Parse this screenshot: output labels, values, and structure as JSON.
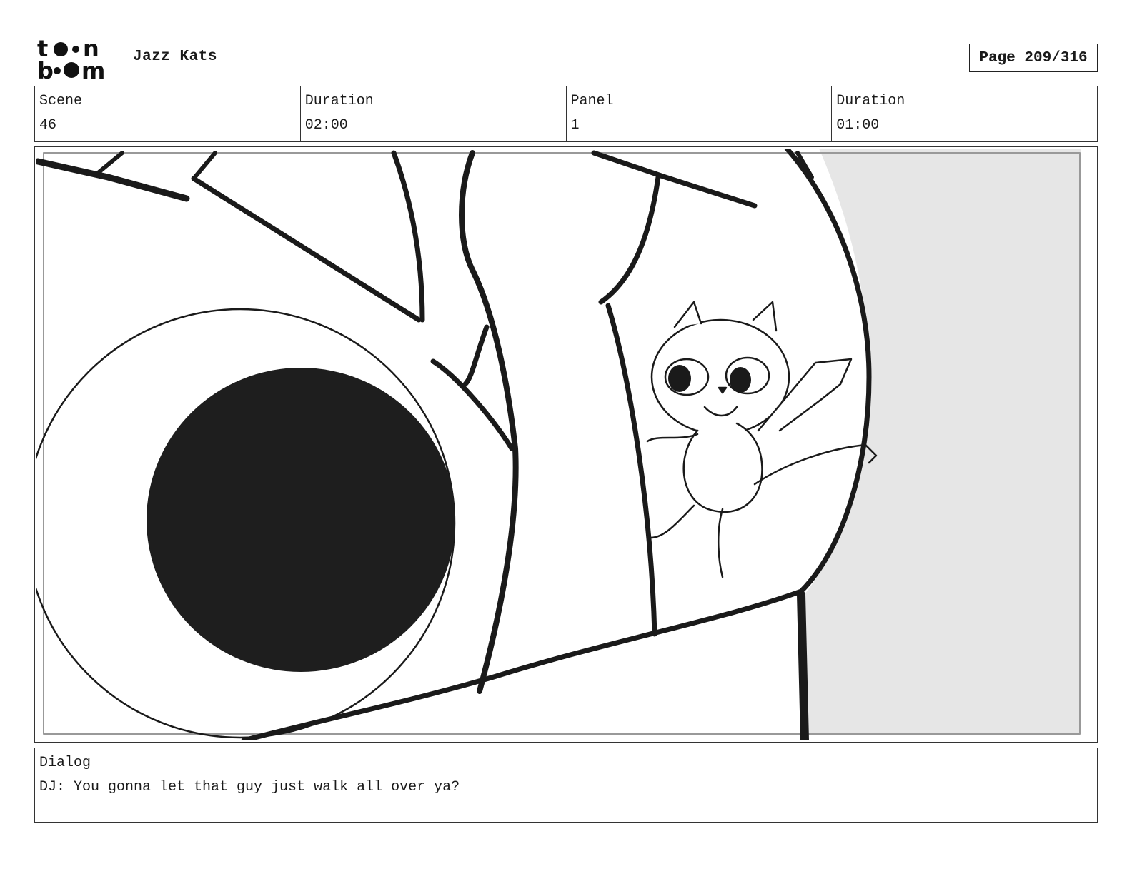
{
  "header": {
    "logo_top": "to•n",
    "logo_bottom": "b•om",
    "project_title": "Jazz Kats",
    "page_label": "Page 209/316"
  },
  "info": {
    "scene_label": "Scene",
    "scene_value": "46",
    "scene_duration_label": "Duration",
    "scene_duration_value": "02:00",
    "panel_label": "Panel",
    "panel_value": "1",
    "panel_duration_label": "Duration",
    "panel_duration_value": "01:00"
  },
  "dialog": {
    "label": "Dialog",
    "text": "DJ: You gonna let that guy just walk all over ya?"
  }
}
